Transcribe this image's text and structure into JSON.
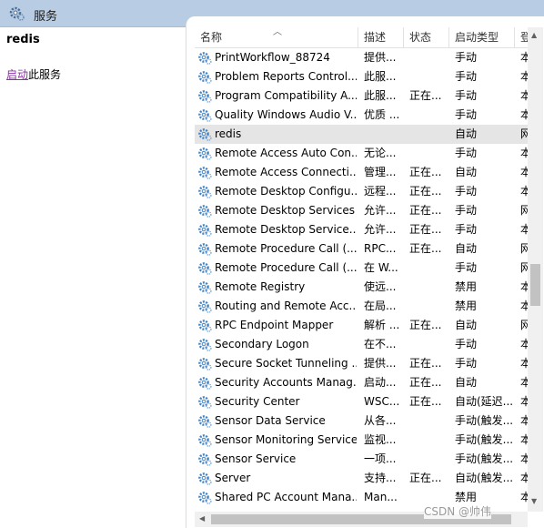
{
  "window": {
    "title": "服务"
  },
  "left_pane": {
    "service_name": "redis",
    "action_link": "启动",
    "action_suffix": "此服务"
  },
  "table": {
    "columns": [
      "名称",
      "描述",
      "状态",
      "启动类型",
      "登"
    ],
    "rows": [
      {
        "name": "PrintWorkflow_88724",
        "desc": "提供...",
        "status": "",
        "startup": "手动",
        "logon": "本"
      },
      {
        "name": "Problem Reports Control...",
        "desc": "此服...",
        "status": "",
        "startup": "手动",
        "logon": "本"
      },
      {
        "name": "Program Compatibility A...",
        "desc": "此服...",
        "status": "正在...",
        "startup": "手动",
        "logon": "本"
      },
      {
        "name": "Quality Windows Audio V...",
        "desc": "优质 ...",
        "status": "",
        "startup": "手动",
        "logon": "本"
      },
      {
        "name": "redis",
        "desc": "",
        "status": "",
        "startup": "自动",
        "logon": "网",
        "selected": true
      },
      {
        "name": "Remote Access Auto Con...",
        "desc": "无论...",
        "status": "",
        "startup": "手动",
        "logon": "本"
      },
      {
        "name": "Remote Access Connecti...",
        "desc": "管理...",
        "status": "正在...",
        "startup": "自动",
        "logon": "本"
      },
      {
        "name": "Remote Desktop Configu...",
        "desc": "远程...",
        "status": "正在...",
        "startup": "手动",
        "logon": "本"
      },
      {
        "name": "Remote Desktop Services",
        "desc": "允许...",
        "status": "正在...",
        "startup": "手动",
        "logon": "网"
      },
      {
        "name": "Remote Desktop Service...",
        "desc": "允许...",
        "status": "正在...",
        "startup": "手动",
        "logon": "本"
      },
      {
        "name": "Remote Procedure Call (...",
        "desc": "RPC...",
        "status": "正在...",
        "startup": "自动",
        "logon": "网"
      },
      {
        "name": "Remote Procedure Call (...",
        "desc": "在 W...",
        "status": "",
        "startup": "手动",
        "logon": "网"
      },
      {
        "name": "Remote Registry",
        "desc": "使远...",
        "status": "",
        "startup": "禁用",
        "logon": "本"
      },
      {
        "name": "Routing and Remote Acc...",
        "desc": "在局...",
        "status": "",
        "startup": "禁用",
        "logon": "本"
      },
      {
        "name": "RPC Endpoint Mapper",
        "desc": "解析 ...",
        "status": "正在...",
        "startup": "自动",
        "logon": "网"
      },
      {
        "name": "Secondary Logon",
        "desc": "在不...",
        "status": "",
        "startup": "手动",
        "logon": "本"
      },
      {
        "name": "Secure Socket Tunneling ...",
        "desc": "提供...",
        "status": "正在...",
        "startup": "手动",
        "logon": "本"
      },
      {
        "name": "Security Accounts Manag...",
        "desc": "启动...",
        "status": "正在...",
        "startup": "自动",
        "logon": "本"
      },
      {
        "name": "Security Center",
        "desc": "WSC...",
        "status": "正在...",
        "startup": "自动(延迟...",
        "logon": "本"
      },
      {
        "name": "Sensor Data Service",
        "desc": "从各...",
        "status": "",
        "startup": "手动(触发...",
        "logon": "本"
      },
      {
        "name": "Sensor Monitoring Service",
        "desc": "监视...",
        "status": "",
        "startup": "手动(触发...",
        "logon": "本"
      },
      {
        "name": "Sensor Service",
        "desc": "一项...",
        "status": "",
        "startup": "手动(触发...",
        "logon": "本"
      },
      {
        "name": "Server",
        "desc": "支持...",
        "status": "正在...",
        "startup": "自动(触发...",
        "logon": "本"
      },
      {
        "name": "Shared PC Account Mana...",
        "desc": "Man...",
        "status": "",
        "startup": "禁用",
        "logon": "本"
      }
    ]
  },
  "watermark": "CSDN @帅伟",
  "icons": {
    "title": "gear-icon",
    "row": "service-gear-icon"
  },
  "colors": {
    "titlebar": "#b8cde4",
    "selected_row": "#e5e5e5",
    "link": "#8b2fa5"
  }
}
